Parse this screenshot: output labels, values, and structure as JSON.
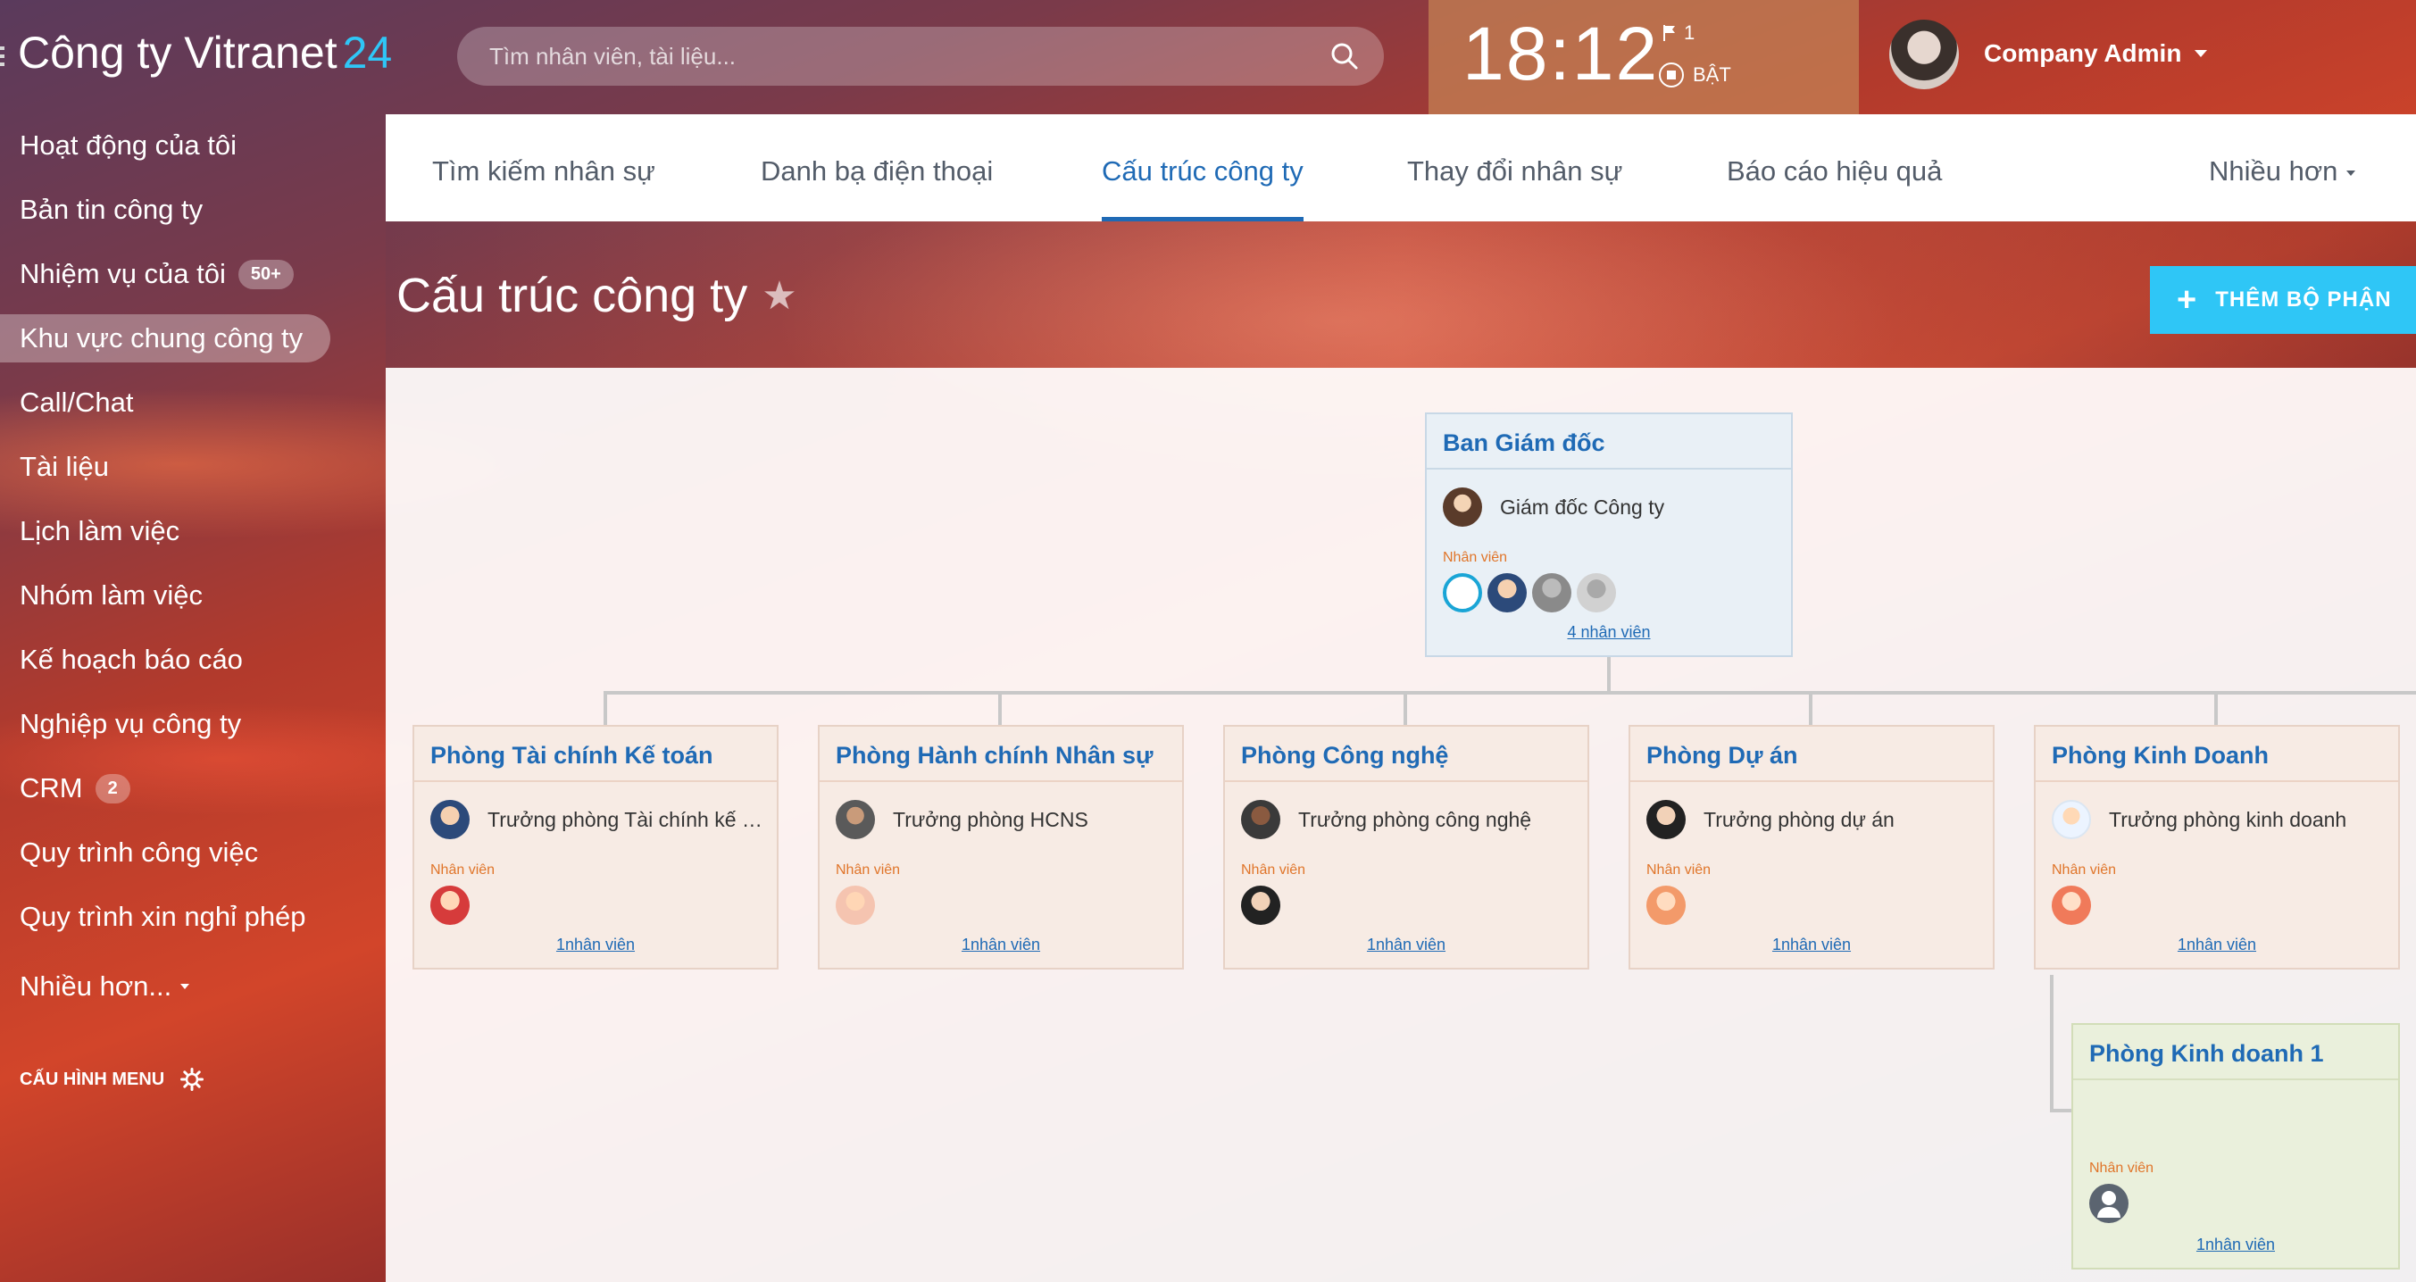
{
  "header": {
    "logo_text": "Công ty Vitranet",
    "logo_num": "24",
    "search_placeholder": "Tìm nhân viên, tài liệu...",
    "clock": "18:12",
    "flag_count": "1",
    "status_label": "BẬT",
    "user_name": "Company Admin"
  },
  "sidebar": {
    "items": [
      {
        "label": "Hoạt động của tôi"
      },
      {
        "label": "Bản tin công ty"
      },
      {
        "label": "Nhiệm vụ của tôi",
        "badge": "50+"
      },
      {
        "label": "Khu vực chung công ty",
        "active": true
      },
      {
        "label": "Call/Chat"
      },
      {
        "label": "Tài liệu"
      },
      {
        "label": "Lịch làm việc"
      },
      {
        "label": "Nhóm làm việc"
      },
      {
        "label": "Kế hoạch báo cáo"
      },
      {
        "label": "Nghiệp vụ công ty"
      },
      {
        "label": "CRM",
        "badge": "2"
      },
      {
        "label": "Quy trình công việc"
      },
      {
        "label": "Quy trình xin nghỉ phép"
      },
      {
        "label": "Nhiều hơn..."
      }
    ],
    "config_label": "CẤU HÌNH MENU"
  },
  "tabs": [
    {
      "label": "Tìm kiếm nhân sự"
    },
    {
      "label": "Danh bạ điện thoại"
    },
    {
      "label": "Cấu trúc công ty",
      "active": true
    },
    {
      "label": "Thay đổi nhân sự"
    },
    {
      "label": "Báo cáo hiệu quả"
    },
    {
      "label": "Nhiều hơn"
    }
  ],
  "page": {
    "title": "Cấu trúc công ty",
    "add_button": "THÊM BỘ PHẬN"
  },
  "org": {
    "staff_label": "Nhân viên",
    "director": {
      "name": "Ban Giám đốc",
      "head": "Giám đốc Công ty",
      "count_link": "4 nhân viên"
    },
    "departments": [
      {
        "name": "Phòng Tài chính Kế toán",
        "head": "Trưởng phòng Tài chính kế toán",
        "count_link": "1nhân viên"
      },
      {
        "name": "Phòng Hành chính Nhân sự",
        "head": "Trưởng phòng HCNS",
        "count_link": "1nhân viên"
      },
      {
        "name": "Phòng Công nghệ",
        "head": "Trưởng phòng công nghệ",
        "count_link": "1nhân viên"
      },
      {
        "name": "Phòng Dự án",
        "head": "Trưởng phòng dự án",
        "count_link": "1nhân viên"
      },
      {
        "name": "Phòng Kinh Doanh",
        "head": "Trưởng phòng kinh doanh",
        "count_link": "1nhân viên"
      }
    ],
    "sub_department": {
      "name": "Phòng Kinh doanh 1",
      "count_link": "1nhân viên"
    }
  },
  "colors": {
    "accent": "#1f6ab5",
    "brand_blue": "#2fc6f6",
    "staff_label": "#e0752a"
  }
}
